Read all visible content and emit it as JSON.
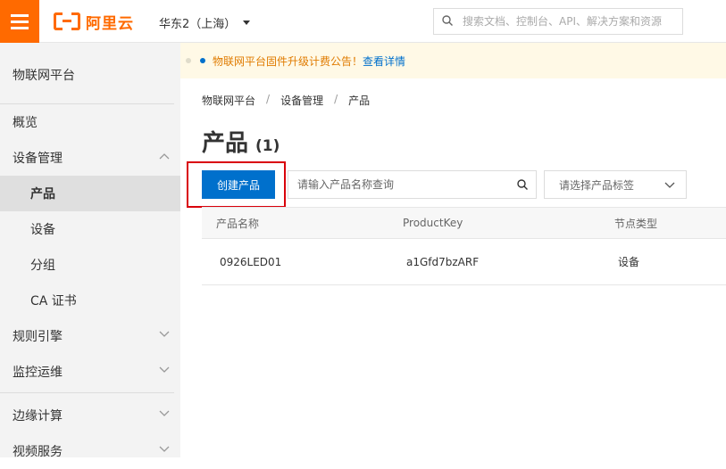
{
  "header": {
    "logo_text": "阿里云",
    "region": "华东2（上海）",
    "search_placeholder": "搜索文档、控制台、API、解决方案和资源"
  },
  "sidebar": {
    "title": "物联网平台",
    "items": [
      {
        "label": "概览"
      },
      {
        "label": "设备管理",
        "expanded": true
      },
      {
        "label": "产品",
        "active": true
      },
      {
        "label": "设备"
      },
      {
        "label": "分组"
      },
      {
        "label": "CA 证书"
      },
      {
        "label": "规则引擎"
      },
      {
        "label": "监控运维"
      },
      {
        "label": "边缘计算"
      },
      {
        "label": "视频服务"
      }
    ]
  },
  "notice": {
    "text": "物联网平台固件升级计费公告！",
    "link": "查看详情"
  },
  "breadcrumb": [
    "物联网平台",
    "设备管理",
    "产品"
  ],
  "breadcrumb_separator": "/",
  "page": {
    "title": "产品",
    "count": "(1)"
  },
  "toolbar": {
    "create_label": "创建产品",
    "name_placeholder": "请输入产品名称查询",
    "tag_placeholder": "请选择产品标签"
  },
  "table": {
    "headers": [
      "产品名称",
      "ProductKey",
      "节点类型"
    ],
    "rows": [
      [
        "0926LED01",
        "a1Gfd7bzARF",
        "设备"
      ]
    ]
  },
  "colors": {
    "brand": "#ff6a00",
    "primary": "#0070cc",
    "highlight_border": "#d9000b",
    "notice_bg": "#fff9e6"
  }
}
